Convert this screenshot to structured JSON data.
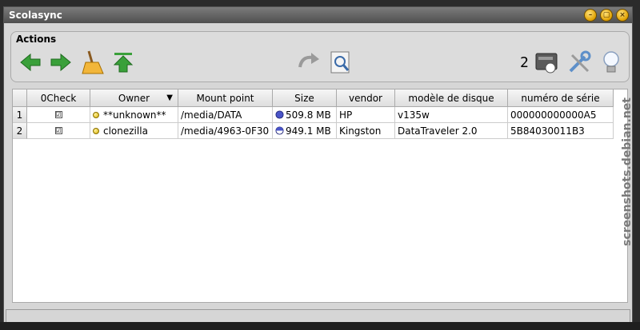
{
  "window": {
    "title": "Scolasync"
  },
  "actions": {
    "label": "Actions",
    "count": "2"
  },
  "table": {
    "columns": [
      "0Check",
      "Owner",
      "Mount point",
      "Size",
      "vendor",
      "modèle de disque",
      "numéro de série"
    ],
    "rows": [
      {
        "num": "1",
        "check": "☑",
        "owner": "**unknown**",
        "mount": "/media/DATA",
        "size": "509.8 MB",
        "vendor": "HP",
        "model": "v135w",
        "serial": "000000000000A5"
      },
      {
        "num": "2",
        "check": "☑",
        "owner": "clonezilla",
        "mount": "/media/4963-0F30",
        "size": "949.1 MB",
        "vendor": "Kingston",
        "model": "DataTraveler 2.0",
        "serial": "5B84030011B3"
      }
    ]
  },
  "watermark": "screenshots.debian.net",
  "colors": {
    "arrow_green": "#3aa03a",
    "title_bar": "#5a5a5a",
    "window_button": "#e0a000"
  }
}
